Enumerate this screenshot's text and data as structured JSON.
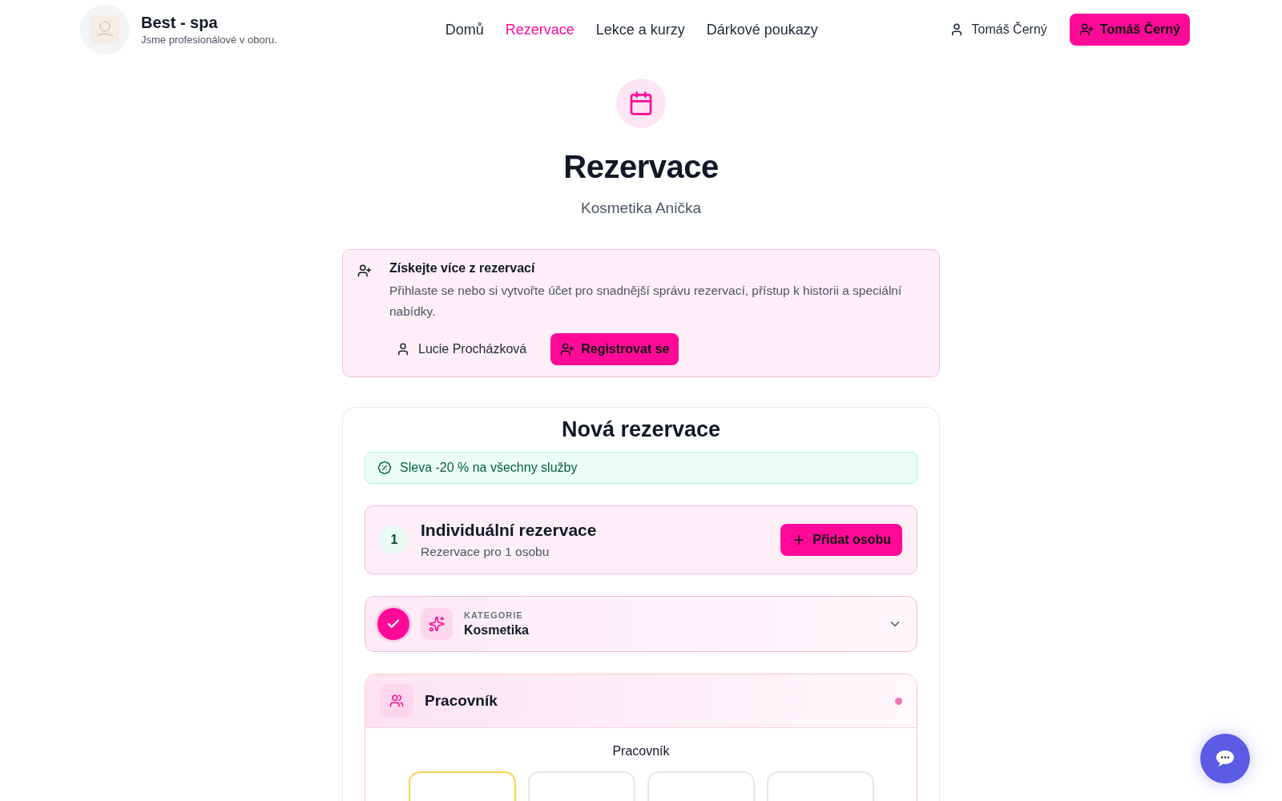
{
  "header": {
    "brand": {
      "name": "Best - spa",
      "tagline": "Jsme profesionálové v oboru."
    },
    "nav": [
      {
        "label": "Domů",
        "selected": false
      },
      {
        "label": "Rezervace",
        "selected": true
      },
      {
        "label": "Lekce a kurzy",
        "selected": false
      },
      {
        "label": "Dárkové poukazy",
        "selected": false
      }
    ],
    "login_link": "Tomáš Černý",
    "register_button": "Tomáš Černý"
  },
  "hero": {
    "title": "Rezervace",
    "subtitle": "Kosmetika Anička"
  },
  "account_notice": {
    "title": "Získejte více z rezervací",
    "text": "Přihlaste se nebo si vytvořte účet pro snadnější správu rezervací, přístup k historii a speciální nabídky.",
    "login_link": "Lucie Procházková",
    "register_button": "Registrovat se"
  },
  "booking": {
    "title": "Nová rezervace",
    "discount": "Sleva -20 % na všechny služby",
    "group": {
      "count": "1",
      "title": "Individuální rezervace",
      "subtitle": "Rezervace pro 1 osobu",
      "add_button": "Přidat osobu"
    },
    "steps": [
      {
        "kind": "collapsed",
        "label": "KATEGORIE",
        "value": "Kosmetika",
        "completed": true
      },
      {
        "kind": "open",
        "title": "Pracovník",
        "active": true,
        "section_label": "Pracovník",
        "options": [
          {
            "selected": true
          },
          {
            "selected": false
          },
          {
            "selected": false
          },
          {
            "selected": false
          }
        ]
      }
    ]
  }
}
